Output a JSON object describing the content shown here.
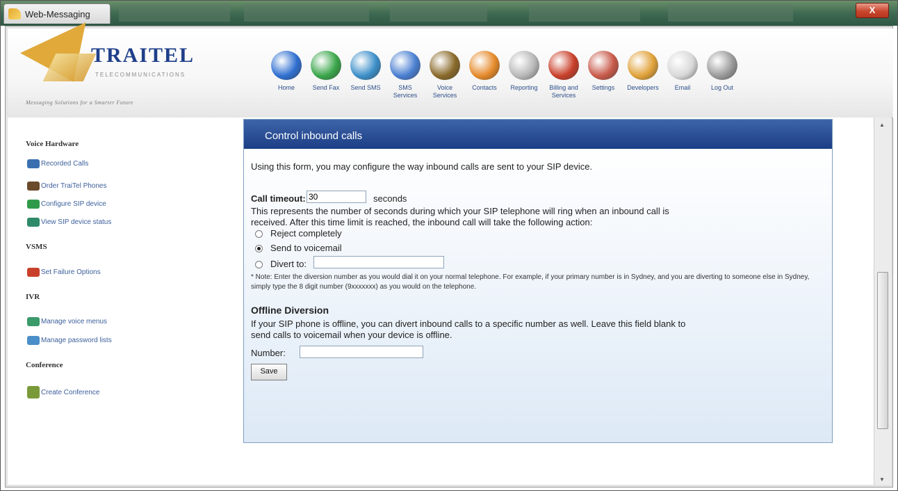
{
  "window": {
    "title": "Web-Messaging",
    "close_label": "X"
  },
  "brand": {
    "name": "TRAITEL",
    "subtitle": "TELECOMMUNICATIONS",
    "tagline": "Messaging Solutions for a Smarter Future"
  },
  "nav": [
    {
      "label": "Home",
      "icon": "globe-icon",
      "color": "#2f6fd0"
    },
    {
      "label": "Send Fax",
      "icon": "fax-icon",
      "color": "#3aa64a"
    },
    {
      "label": "Send SMS",
      "icon": "sms-icon",
      "color": "#3d8fc9"
    },
    {
      "label": "SMS\nServices",
      "icon": "sms-services-icon",
      "color": "#4a7fd1"
    },
    {
      "label": "Voice\nServices",
      "icon": "phone-icon",
      "color": "#8a6a2a"
    },
    {
      "label": "Contacts",
      "icon": "contacts-icon",
      "color": "#e58a2a"
    },
    {
      "label": "Reporting",
      "icon": "reporting-icon",
      "color": "#b8b8b8"
    },
    {
      "label": "Billing and\nServices",
      "icon": "billing-icon",
      "color": "#c9402a"
    },
    {
      "label": "Settings",
      "icon": "settings-icon",
      "color": "#c85a4a"
    },
    {
      "label": "Developers",
      "icon": "developers-icon",
      "color": "#e0a23a"
    },
    {
      "label": "Email",
      "icon": "email-icon",
      "color": "#d8d8d8"
    },
    {
      "label": "Log Out",
      "icon": "trash-icon",
      "color": "#9a9a9a"
    }
  ],
  "sidebar": {
    "voice_hardware": "Voice Hardware",
    "recorded_calls": "Recorded Calls",
    "order_phones": "Order TraiTel Phones",
    "configure_sip": "Configure SIP device",
    "view_sip": "View SIP device status",
    "vsms": "VSMS",
    "set_failure": "Set Failure Options",
    "ivr": "IVR",
    "manage_menus": "Manage voice menus",
    "manage_passwords": "Manage password lists",
    "conference": "Conference",
    "create_conference": "Create Conference"
  },
  "panel": {
    "title": "Control inbound calls",
    "intro": "Using this form, you may configure the way inbound calls are sent to your SIP device.",
    "call_timeout_label": "Call timeout:",
    "call_timeout_value": "30",
    "seconds_label": "seconds",
    "desc_line1": "This represents the number of seconds during which your SIP telephone will ring when an inbound call is",
    "desc_line2": "received. After this time limit is reached, the inbound call will take the following action:",
    "option_reject": "Reject completely",
    "option_voicemail": "Send to voicemail",
    "option_divert": "Divert to:",
    "divert_value": "",
    "note": "* Note: Enter the diversion number as you would dial it on your normal telephone. For example, if your primary number is in Sydney, and you are diverting to someone else in Sydney, simply type the 8 digit number (9xxxxxxx) as you would on the telephone.",
    "offline_title": "Offline Diversion",
    "offline_line1": "If your SIP phone is offline, you can divert inbound calls to a specific number as well. Leave this field blank to",
    "offline_line2": "send calls to voicemail when your device is offline.",
    "number_label": "Number:",
    "number_value": "",
    "save_label": "Save"
  }
}
